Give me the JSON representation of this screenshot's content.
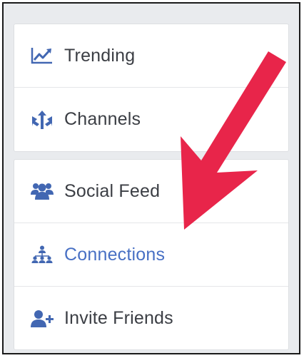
{
  "nav": {
    "primary": [
      {
        "label": "Trending",
        "icon": "trending-chart-icon"
      },
      {
        "label": "Channels",
        "icon": "channels-icon"
      }
    ],
    "secondary": [
      {
        "label": "Social Feed",
        "icon": "social-feed-icon"
      },
      {
        "label": "Connections",
        "icon": "connections-icon",
        "active": true
      },
      {
        "label": "Invite Friends",
        "icon": "invite-friends-icon"
      }
    ]
  },
  "colors": {
    "icon_blue": "#4267b2",
    "active_text": "#4870c4",
    "text": "#3b3e44",
    "annotation_arrow": "#e8254a"
  }
}
